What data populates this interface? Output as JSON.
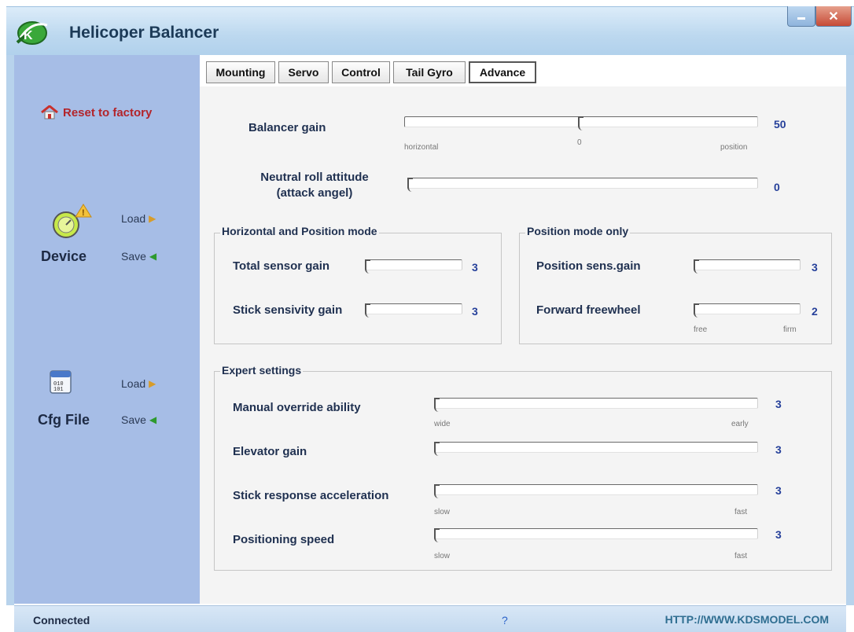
{
  "window": {
    "title": "Helicoper Balancer",
    "minimize_icon": "minimize-icon",
    "close_label": "✕"
  },
  "sidebar": {
    "reset_label": "Reset to factory",
    "device": {
      "label": "Device",
      "load_label": "Load",
      "save_label": "Save"
    },
    "cfg": {
      "label": "Cfg File",
      "load_label": "Load",
      "save_label": "Save"
    }
  },
  "tabs": [
    "Mounting",
    "Servo",
    "Control",
    "Tail Gyro",
    "Advance"
  ],
  "active_tab": "Advance",
  "advance": {
    "balancer_gain": {
      "label": "Balancer gain",
      "value": "50",
      "level": 0.5,
      "ticks": [
        "horizontal",
        "0",
        "position"
      ]
    },
    "neutral_roll": {
      "label_line1": "Neutral roll attitude",
      "label_line2": "(attack angel)",
      "value": "0",
      "level": 0.0
    },
    "horizontal_position_group": {
      "title": "Horizontal and Position mode",
      "total_sensor_gain": {
        "label": "Total sensor gain",
        "value": "3",
        "level": 0.0
      },
      "stick_sensivity_gain": {
        "label": "Stick sensivity gain",
        "value": "3",
        "level": 0.0
      }
    },
    "position_only_group": {
      "title": "Position mode only",
      "position_sens_gain": {
        "label": "Position sens.gain",
        "value": "3",
        "level": 0.0
      },
      "forward_freewheel": {
        "label": "Forward freewheel",
        "value": "2",
        "level": 0.0,
        "ticks": [
          "free",
          "firm"
        ]
      }
    },
    "expert_group": {
      "title": "Expert settings",
      "manual_override": {
        "label": "Manual override ability",
        "value": "3",
        "level": 0.0,
        "ticks": [
          "wide",
          "early"
        ]
      },
      "elevator_gain": {
        "label": "Elevator gain",
        "value": "3",
        "level": 0.0
      },
      "stick_response": {
        "label": "Stick response acceleration",
        "value": "3",
        "level": 0.0,
        "ticks": [
          "slow",
          "fast"
        ]
      },
      "positioning_speed": {
        "label": "Positioning speed",
        "value": "3",
        "level": 0.0,
        "ticks": [
          "slow",
          "fast"
        ]
      }
    }
  },
  "status": {
    "connection": "Connected",
    "help": "?",
    "url": "HTTP://WWW.KDSMODEL.COM"
  },
  "colors": {
    "sidebar": "#a6bde6",
    "value_text": "#26409a",
    "reset_text": "#b3242a",
    "url_text": "#2f6e91"
  }
}
